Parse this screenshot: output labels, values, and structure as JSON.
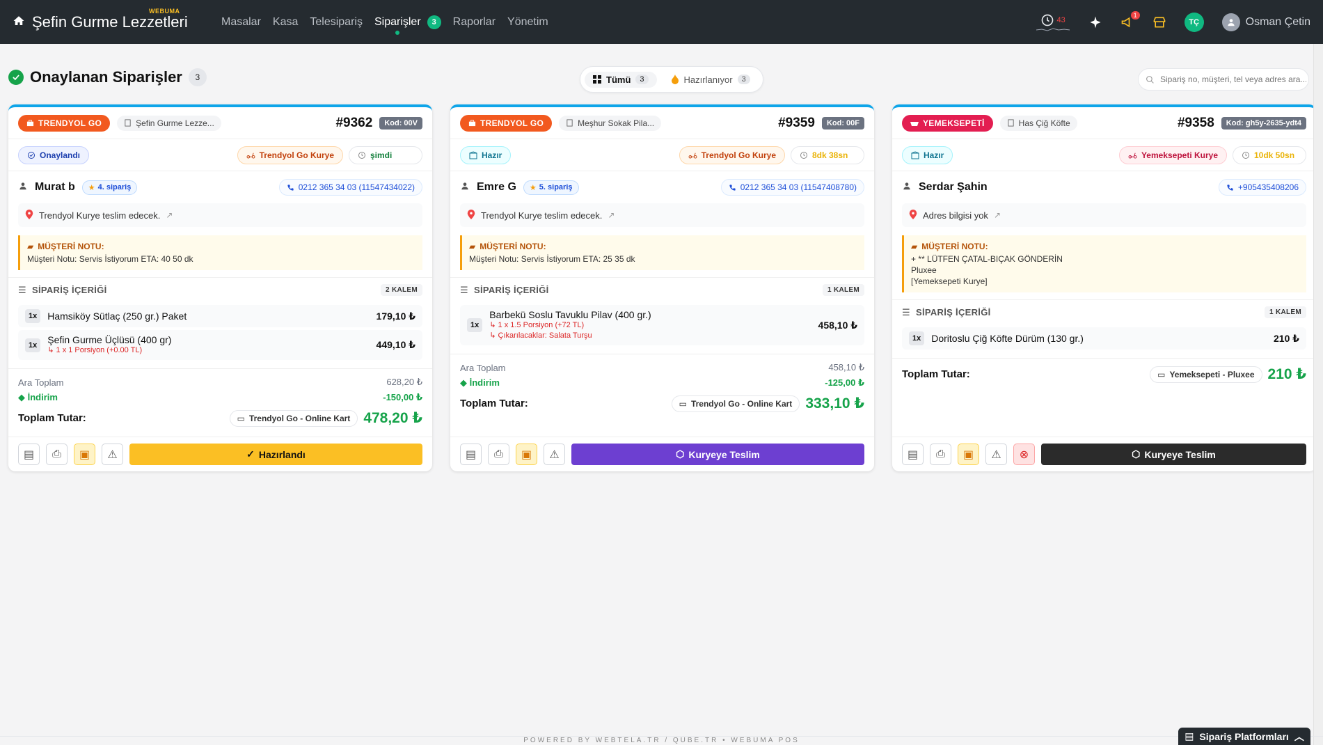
{
  "app": {
    "brand": "Şefin Gurme Lezzetleri",
    "brand_tag": "WEBUMA",
    "nav": [
      {
        "label": "Masalar"
      },
      {
        "label": "Kasa"
      },
      {
        "label": "Telesipariş"
      },
      {
        "label": "Siparişler",
        "active": true
      },
      {
        "label": "Raporlar"
      },
      {
        "label": "Yönetim"
      }
    ],
    "orders_count": "3",
    "clock_count": "43",
    "notif_count": "1",
    "avatar_initials": "TÇ",
    "user_name": "Osman Çetin",
    "icons": [
      "home-icon",
      "clock-icon",
      "sparkle-icon",
      "megaphone-icon",
      "store-icon",
      "user-icon"
    ]
  },
  "page": {
    "title": "Onaylanan Siparişler",
    "count": "3",
    "filters": [
      {
        "label": "Tümü",
        "count": "3",
        "active": true
      },
      {
        "label": "Hazırlanıyor",
        "count": "3",
        "active": false
      }
    ],
    "search_placeholder": "Sipariş no, müşteri, tel veya adres ara..."
  },
  "orders": [
    {
      "platform": "TRENDYOL GO",
      "restaurant": "Şefin Gurme Lezze...",
      "order_no": "#9362",
      "code": "Kod: 00V",
      "status": "Onaylandı",
      "courier": "Trendyol Go Kurye",
      "time": "şimdi",
      "customer": "Murat b",
      "order_count": "4. sipariş",
      "phone": "0212 365 34 03 (11547434022)",
      "address": "Trendyol Kurye teslim edecek.",
      "note_title": "MÜŞTERİ NOTU:",
      "note": "Müşteri Notu: Servis İstiyorum ETA: 40 50 dk",
      "section": "SİPARİŞ İÇERİĞİ",
      "items_count": "2 KALEM",
      "items": [
        {
          "qty": "1x",
          "name": "Hamsiköy Sütlaç (250 gr.) Paket",
          "price": "179,10 ₺"
        },
        {
          "qty": "1x",
          "name": "Şefin Gurme Üçlüsü (400 gr)",
          "sub1": "↳ 1 x 1 Porsiyon (+0.00 TL)",
          "price": "449,10 ₺"
        }
      ],
      "subtotal_label": "Ara Toplam",
      "subtotal": "628,20 ₺",
      "discount_label": "İndirim",
      "discount": "-150,00 ₺",
      "total_label": "Toplam Tutar:",
      "payment": "Trendyol Go - Online Kart",
      "total": "478,20 ₺",
      "action": "Hazırlandı"
    },
    {
      "platform": "TRENDYOL GO",
      "restaurant": "Meşhur Sokak Pila...",
      "order_no": "#9359",
      "code": "Kod: 00F",
      "status": "Hazır",
      "courier": "Trendyol Go Kurye",
      "time": "8dk 38sn",
      "customer": "Emre G",
      "order_count": "5. sipariş",
      "phone": "0212 365 34 03 (11547408780)",
      "address": "Trendyol Kurye teslim edecek.",
      "note_title": "MÜŞTERİ NOTU:",
      "note": "Müşteri Notu: Servis İstiyorum ETA: 25 35 dk",
      "section": "SİPARİŞ İÇERİĞİ",
      "items_count": "1 KALEM",
      "items": [
        {
          "qty": "1x",
          "name": "Barbekü Soslu Tavuklu Pilav (400 gr.)",
          "sub1": "↳ 1 x 1.5 Porsiyon (+72 TL)",
          "sub2": "↳ Çıkarılacaklar: Salata Turşu",
          "price": "458,10 ₺"
        }
      ],
      "subtotal_label": "Ara Toplam",
      "subtotal": "458,10 ₺",
      "discount_label": "İndirim",
      "discount": "-125,00 ₺",
      "total_label": "Toplam Tutar:",
      "payment": "Trendyol Go - Online Kart",
      "total": "333,10 ₺",
      "action": "Kuryeye Teslim"
    },
    {
      "platform": "YEMEKSEPETİ",
      "restaurant": "Has Çiğ Köfte",
      "order_no": "#9358",
      "code": "Kod: gh5y-2635-ydt4",
      "status": "Hazır",
      "courier": "Yemeksepeti Kurye",
      "time": "10dk 50sn",
      "customer": "Serdar Şahin",
      "phone": "+905435408206",
      "address": "Adres bilgisi yok",
      "note_title": "MÜŞTERİ NOTU:",
      "note_lines": [
        "+ ** LÜTFEN ÇATAL-BIÇAK GÖNDERİN",
        "Pluxee",
        "[Yemeksepeti Kurye]"
      ],
      "section": "SİPARİŞ İÇERİĞİ",
      "items_count": "1 KALEM",
      "items": [
        {
          "qty": "1x",
          "name": "Doritoslu Çiğ Köfte Dürüm (130 gr.)",
          "price": "210 ₺"
        }
      ],
      "total_label": "Toplam Tutar:",
      "payment": "Yemeksepeti - Pluxee",
      "total": "210 ₺",
      "action": "Kuryeye Teslim"
    }
  ],
  "footer": "POWERED BY WEBTELA.TR / QUBE.TR • WEBUMA POS",
  "platform_button": "Sipariş Platformları"
}
